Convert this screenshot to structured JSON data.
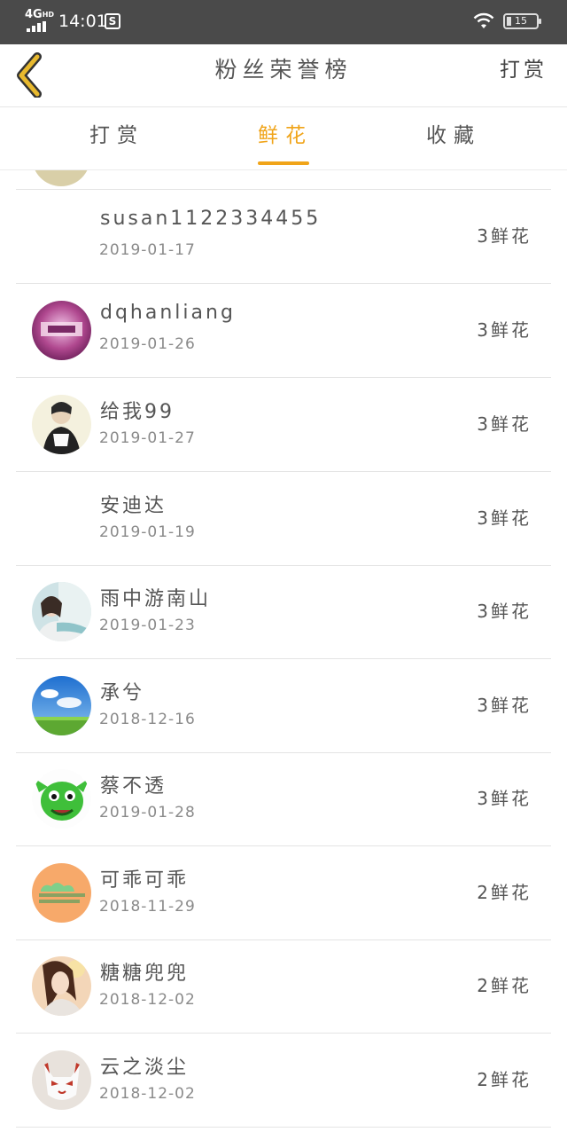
{
  "status_bar": {
    "network": "4G",
    "network_sup": "HD",
    "time": "14:01",
    "app_icon": "S",
    "wifi_icon": "wifi-icon",
    "battery_level": "15",
    "signal_bars": 4
  },
  "nav": {
    "back_icon": "chevron-left-icon",
    "title": "粉丝荣誉榜",
    "right_action": "打赏"
  },
  "tabs": [
    {
      "label": "打赏",
      "active": false
    },
    {
      "label": "鲜花",
      "active": true
    },
    {
      "label": "收藏",
      "active": false
    }
  ],
  "colors": {
    "accent": "#f0a419",
    "status_bar": "#4a4a4a",
    "back_icon": "#e8b92e"
  },
  "fans": [
    {
      "name": "susan1122334455",
      "date": "2019-01-17",
      "count": "3鲜花",
      "avatar": "none"
    },
    {
      "name": "dqhanliang",
      "date": "2019-01-26",
      "count": "3鲜花",
      "avatar": "purple-avatar"
    },
    {
      "name": "给我99",
      "date": "2019-01-27",
      "count": "3鲜花",
      "avatar": "person-avatar"
    },
    {
      "name": "安迪达",
      "date": "2019-01-19",
      "count": "3鲜花",
      "avatar": "none"
    },
    {
      "name": "雨中游南山",
      "date": "2019-01-23",
      "count": "3鲜花",
      "avatar": "girl-avatar"
    },
    {
      "name": "承兮",
      "date": "2018-12-16",
      "count": "3鲜花",
      "avatar": "sky-avatar"
    },
    {
      "name": "蔡不透",
      "date": "2019-01-28",
      "count": "3鲜花",
      "avatar": "green-cartoon-avatar"
    },
    {
      "name": "可乖可乖",
      "date": "2018-11-29",
      "count": "2鲜花",
      "avatar": "orange-avatar"
    },
    {
      "name": "糖糖兜兜",
      "date": "2018-12-02",
      "count": "2鲜花",
      "avatar": "woman-avatar"
    },
    {
      "name": "云之淡尘",
      "date": "2018-12-02",
      "count": "2鲜花",
      "avatar": "fox-mask-avatar"
    }
  ]
}
